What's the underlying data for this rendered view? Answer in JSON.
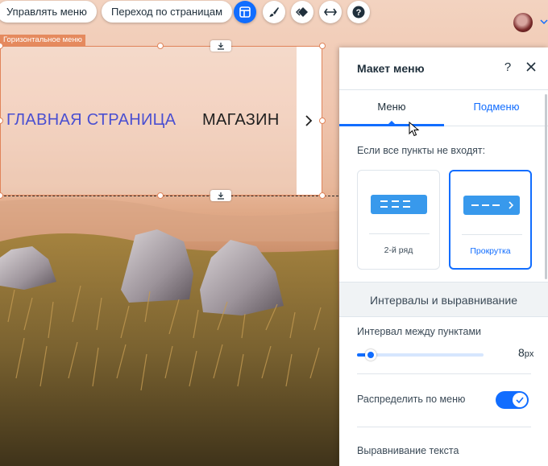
{
  "toolbar": {
    "manage_menu_label": "Управлять меню",
    "page_nav_label": "Переход по страницам"
  },
  "element": {
    "label": "Горизонтальное меню",
    "items": [
      "ГЛАВНАЯ СТРАНИЦА",
      "МАГАЗИН"
    ]
  },
  "panel": {
    "title": "Макет меню",
    "help_label": "?",
    "tabs": [
      {
        "label": "Меню",
        "active": true
      },
      {
        "label": "Подменю",
        "active": false
      }
    ],
    "overflow_label": "Если все пункты не входят:",
    "overflow_options": [
      {
        "label": "2-й ряд",
        "selected": false
      },
      {
        "label": "Прокрутка",
        "selected": true
      }
    ],
    "section_title": "Интервалы и выравнивание",
    "spacing_label": "Интервал между пунктами",
    "spacing_value": "8",
    "spacing_unit": "px",
    "distribute_label": "Распределить по меню",
    "distribute_on": true,
    "text_align_label": "Выравнивание текста"
  },
  "colors": {
    "accent": "#116dff",
    "selection": "#e0845a",
    "menu_active_text": "#4a4fd1"
  }
}
